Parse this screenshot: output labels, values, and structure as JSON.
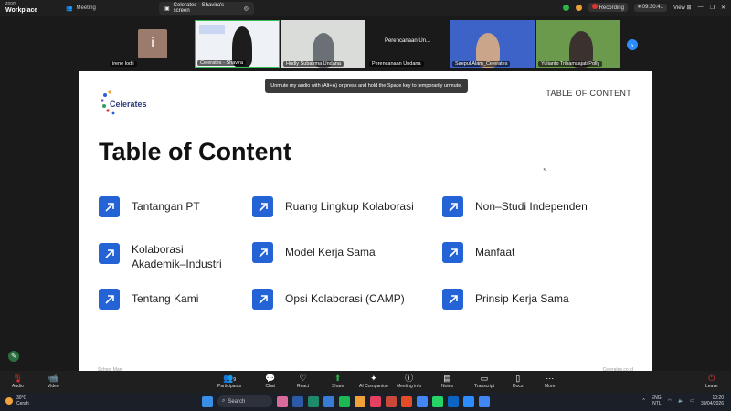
{
  "titlebar": {
    "brand_top": "zoom",
    "brand_bottom": "Workplace",
    "meeting_tab": "Meeting",
    "share_tab": "Celerates - Shavira's screen",
    "recording_label": "Recording",
    "recording_time": "09:30:41",
    "view_label": "View"
  },
  "participants": [
    {
      "name": "irene lodji",
      "initial": "i"
    },
    {
      "name": "Celerates - Shavira"
    },
    {
      "name": "Hudly Subairma Undana"
    },
    {
      "name": "Perencanaan Undana",
      "display": "Perencanaan Un..."
    },
    {
      "name": "Saepul Alam_Celerates"
    },
    {
      "name": "Yulianto Trihamsajati Polly"
    }
  ],
  "tooltip": "Unmute my audio with (Alt+A) or press and hold the Space key to temporarily unmute.",
  "slide": {
    "logo_text": "Celerates",
    "header": "TABLE OF CONTENT",
    "title": "Table of Content",
    "items": [
      "Tantangan PT",
      "Ruang Lingkup Kolaborasi",
      "Non–Studi Independen",
      "Kolaborasi\nAkademik–Industri",
      "Model Kerja Sama",
      "Manfaat",
      "Tentang Kami",
      "Opsi Kolaborasi (CAMP)",
      "Prinsip Kerja Sama"
    ],
    "footer_left": "School Man",
    "footer_right": "Celerates.co.id",
    "accent": "#2363d6"
  },
  "controls": {
    "audio": "Audio",
    "video": "Video",
    "participants": "Participants",
    "participants_count": "9",
    "chat": "Chat",
    "react": "React",
    "share": "Share",
    "ai": "AI Companion",
    "info": "Meeting info",
    "notes": "Notes",
    "transcript": "Transcript",
    "docs": "Docs",
    "more": "More",
    "leave": "Leave"
  },
  "taskbar": {
    "temp": "30°C",
    "weather": "Cerah",
    "search": "Search",
    "lang1": "ENG",
    "lang2": "INTL",
    "time": "10:20",
    "date": "30/04/2026"
  }
}
